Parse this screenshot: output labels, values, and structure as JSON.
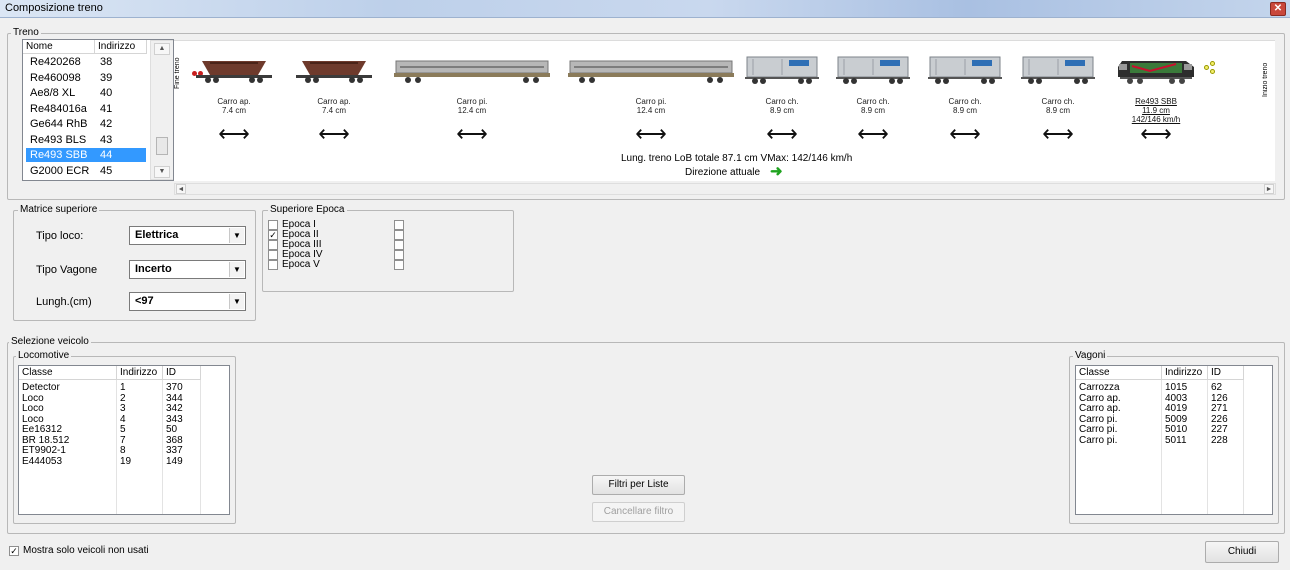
{
  "window": {
    "title": "Composizione treno",
    "close_glyph": "✕"
  },
  "treno": {
    "legend": "Treno",
    "list_headers": [
      "Nome",
      "Indirizzo"
    ],
    "list_rows": [
      {
        "name": "Re420268",
        "addr": "38"
      },
      {
        "name": "Re460098",
        "addr": "39"
      },
      {
        "name": "Ae8/8 XL",
        "addr": "40"
      },
      {
        "name": "Re484016a",
        "addr": "41"
      },
      {
        "name": "Ge644 RhB",
        "addr": "42"
      },
      {
        "name": "Re493 BLS",
        "addr": "43"
      },
      {
        "name": "Re493 SBB",
        "addr": "44"
      },
      {
        "name": "G2000 ECR",
        "addr": "45"
      }
    ],
    "selected_row": 6,
    "fine_treno": "Fine treno",
    "inizio_treno": "Inizio treno",
    "wagons": [
      {
        "label": "Carro ap.",
        "length": "7.4 cm",
        "type": "hopper"
      },
      {
        "label": "Carro ap.",
        "length": "7.4 cm",
        "type": "hopper"
      },
      {
        "label": "Carro pi.",
        "length": "12.4 cm",
        "type": "flat"
      },
      {
        "label": "Carro pi.",
        "length": "12.4 cm",
        "type": "flat"
      },
      {
        "label": "Carro ch.",
        "length": "8.9 cm",
        "type": "boxcar"
      },
      {
        "label": "Carro ch.",
        "length": "8.9 cm",
        "type": "boxcar"
      },
      {
        "label": "Carro ch.",
        "length": "8.9 cm",
        "type": "boxcar"
      },
      {
        "label": "Carro ch.",
        "length": "8.9 cm",
        "type": "boxcar"
      }
    ],
    "loco": {
      "label": "Re493 SBB",
      "length": "11.9 cm",
      "speed": "142/146 km/h"
    },
    "summary": "Lung. treno LoB totale 87.1 cm   VMax: 142/146 km/h",
    "direzione_label": "Direzione attuale",
    "arrow_glyph": "⟷",
    "direction_glyph": "➜",
    "colors": {
      "selection": "#3399ff",
      "direction_arrow": "#1fa31f",
      "lights_red": "#c81e1e"
    }
  },
  "matrice": {
    "legend": "Matrice superiore",
    "tipo_loco_label": "Tipo loco:",
    "tipo_loco_value": "Elettrica",
    "tipo_vagone_label": "Tipo Vagone",
    "tipo_vagone_value": "Incerto",
    "lungh_label": "Lungh.(cm)",
    "lungh_value": "<97",
    "dropdown_glyph": "▼"
  },
  "epoca": {
    "legend": "Superiore Epoca",
    "items": [
      {
        "label": "Epoca I",
        "checked": false
      },
      {
        "label": "Epoca II",
        "checked": true
      },
      {
        "label": "Epoca III",
        "checked": false
      },
      {
        "label": "Epoca IV",
        "checked": false
      },
      {
        "label": "Epoca V",
        "checked": false
      }
    ],
    "check_glyph": "✓"
  },
  "selezione": {
    "legend": "Selezione veicolo",
    "locomotive": {
      "legend": "Locomotive",
      "headers": [
        "Classe",
        "Indirizzo",
        "ID"
      ],
      "rows": [
        [
          "Detector",
          "1",
          "370"
        ],
        [
          "Loco",
          "2",
          "344"
        ],
        [
          "Loco",
          "3",
          "342"
        ],
        [
          "Loco",
          "4",
          "343"
        ],
        [
          "Ee16312",
          "5",
          "50"
        ],
        [
          "BR 18.512",
          "7",
          "368"
        ],
        [
          "ET9902-1",
          "8",
          "337"
        ],
        [
          "E444053",
          "19",
          "149"
        ]
      ]
    },
    "vagoni": {
      "legend": "Vagoni",
      "headers": [
        "Classe",
        "Indirizzo",
        "ID"
      ],
      "rows": [
        [
          "Carrozza",
          "1015",
          "62"
        ],
        [
          "Carro ap.",
          "4003",
          "126"
        ],
        [
          "Carro ap.",
          "4019",
          "271"
        ],
        [
          "Carro pi.",
          "5009",
          "226"
        ],
        [
          "Carro pi.",
          "5010",
          "227"
        ],
        [
          "Carro pi.",
          "5011",
          "228"
        ]
      ]
    },
    "filtri_button": "Filtri per Liste",
    "cancellare_button": "Cancellare filtro"
  },
  "footer": {
    "mostra_label": "Mostra solo veicoli non usati",
    "mostra_checked": true,
    "chiudi_button": "Chiudi"
  }
}
